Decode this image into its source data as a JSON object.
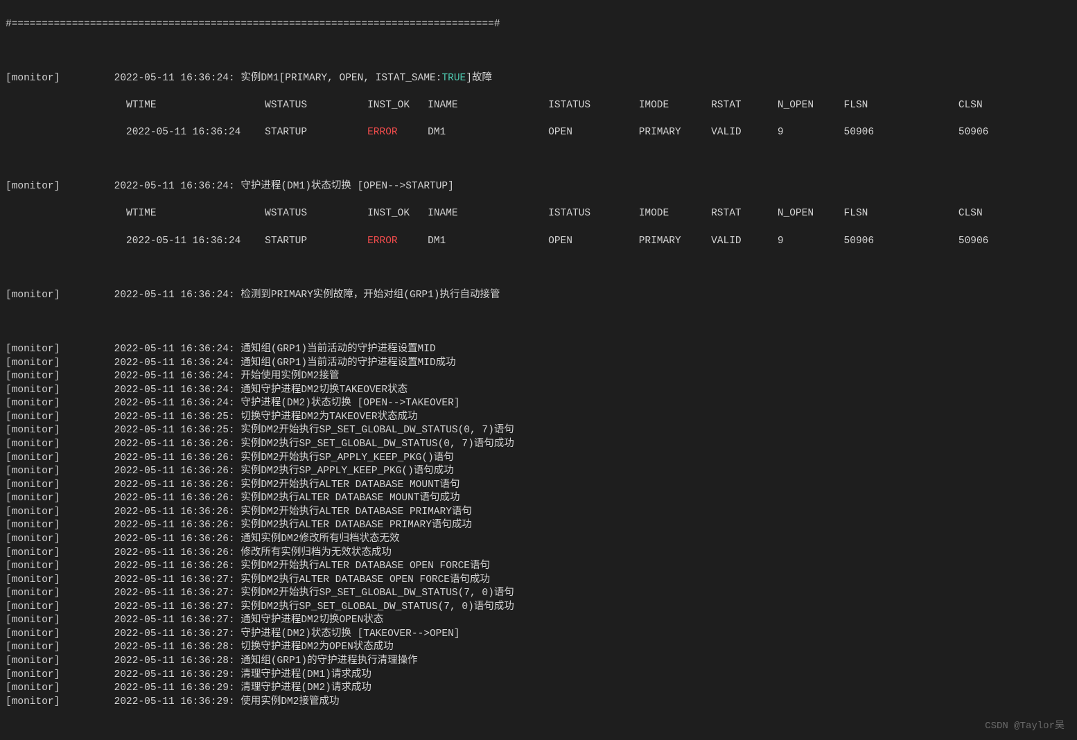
{
  "divider": "#================================================================================#",
  "tag": "[monitor]",
  "pad": "         ",
  "padfull": "                    ",
  "watermark": "CSDN @Taylor吴",
  "block1": {
    "ts": "2022-05-11 16:36:24: ",
    "l1a": "实例DM1[PRIMARY, OPEN, ISTAT_SAME:",
    "true": "TRUE",
    "l1b": "]故障"
  },
  "block2": {
    "ts": "2022-05-11 16:36:24: ",
    "l1": "守护进程(DM1)状态切换 [OPEN-->STARTUP]"
  },
  "hdr": {
    "wtime": "WTIME                  ",
    "wstatus": "WSTATUS          ",
    "inst_ok": "INST_OK   ",
    "iname": "INAME               ",
    "istatus": "ISTATUS        ",
    "imode": "IMODE       ",
    "rstat": "RSTAT      ",
    "nopen": "N_OPEN     ",
    "flsn": "FLSN               ",
    "clsn": "CLSN"
  },
  "val": {
    "wtime": "2022-05-11 16:36:24    ",
    "wstatus": "STARTUP          ",
    "inst_ok": "ERROR     ",
    "iname": "DM1                 ",
    "istatus": "OPEN           ",
    "imode": "PRIMARY     ",
    "rstat": "VALID      ",
    "nopen": "9          ",
    "flsn": "50906              ",
    "clsn": "50906"
  },
  "detect": {
    "ts": "2022-05-11 16:36:24: ",
    "msg": "检测到PRIMARY实例故障，开始对组(GRP1)执行自动接管"
  },
  "logs": [
    {
      "ts": "2022-05-11 16:36:24: ",
      "msg": "通知组(GRP1)当前活动的守护进程设置MID"
    },
    {
      "ts": "2022-05-11 16:36:24: ",
      "msg": "通知组(GRP1)当前活动的守护进程设置MID成功"
    },
    {
      "ts": "2022-05-11 16:36:24: ",
      "msg": "开始使用实例DM2接管"
    },
    {
      "ts": "2022-05-11 16:36:24: ",
      "msg": "通知守护进程DM2切换TAKEOVER状态"
    },
    {
      "ts": "2022-05-11 16:36:24: ",
      "msg": "守护进程(DM2)状态切换 [OPEN-->TAKEOVER]"
    },
    {
      "ts": "2022-05-11 16:36:25: ",
      "msg": "切换守护进程DM2为TAKEOVER状态成功"
    },
    {
      "ts": "2022-05-11 16:36:25: ",
      "msg": "实例DM2开始执行SP_SET_GLOBAL_DW_STATUS(0, 7)语句"
    },
    {
      "ts": "2022-05-11 16:36:26: ",
      "msg": "实例DM2执行SP_SET_GLOBAL_DW_STATUS(0, 7)语句成功"
    },
    {
      "ts": "2022-05-11 16:36:26: ",
      "msg": "实例DM2开始执行SP_APPLY_KEEP_PKG()语句"
    },
    {
      "ts": "2022-05-11 16:36:26: ",
      "msg": "实例DM2执行SP_APPLY_KEEP_PKG()语句成功"
    },
    {
      "ts": "2022-05-11 16:36:26: ",
      "msg": "实例DM2开始执行ALTER DATABASE MOUNT语句"
    },
    {
      "ts": "2022-05-11 16:36:26: ",
      "msg": "实例DM2执行ALTER DATABASE MOUNT语句成功"
    },
    {
      "ts": "2022-05-11 16:36:26: ",
      "msg": "实例DM2开始执行ALTER DATABASE PRIMARY语句"
    },
    {
      "ts": "2022-05-11 16:36:26: ",
      "msg": "实例DM2执行ALTER DATABASE PRIMARY语句成功"
    },
    {
      "ts": "2022-05-11 16:36:26: ",
      "msg": "通知实例DM2修改所有归档状态无效"
    },
    {
      "ts": "2022-05-11 16:36:26: ",
      "msg": "修改所有实例归档为无效状态成功"
    },
    {
      "ts": "2022-05-11 16:36:26: ",
      "msg": "实例DM2开始执行ALTER DATABASE OPEN FORCE语句"
    },
    {
      "ts": "2022-05-11 16:36:27: ",
      "msg": "实例DM2执行ALTER DATABASE OPEN FORCE语句成功"
    },
    {
      "ts": "2022-05-11 16:36:27: ",
      "msg": "实例DM2开始执行SP_SET_GLOBAL_DW_STATUS(7, 0)语句"
    },
    {
      "ts": "2022-05-11 16:36:27: ",
      "msg": "实例DM2执行SP_SET_GLOBAL_DW_STATUS(7, 0)语句成功"
    },
    {
      "ts": "2022-05-11 16:36:27: ",
      "msg": "通知守护进程DM2切换OPEN状态"
    },
    {
      "ts": "2022-05-11 16:36:27: ",
      "msg": "守护进程(DM2)状态切换 [TAKEOVER-->OPEN]"
    },
    {
      "ts": "2022-05-11 16:36:28: ",
      "msg": "切换守护进程DM2为OPEN状态成功"
    },
    {
      "ts": "2022-05-11 16:36:28: ",
      "msg": "通知组(GRP1)的守护进程执行清理操作"
    },
    {
      "ts": "2022-05-11 16:36:29: ",
      "msg": "清理守护进程(DM1)请求成功"
    },
    {
      "ts": "2022-05-11 16:36:29: ",
      "msg": "清理守护进程(DM2)请求成功"
    },
    {
      "ts": "2022-05-11 16:36:29: ",
      "msg": "使用实例DM2接管成功"
    }
  ]
}
